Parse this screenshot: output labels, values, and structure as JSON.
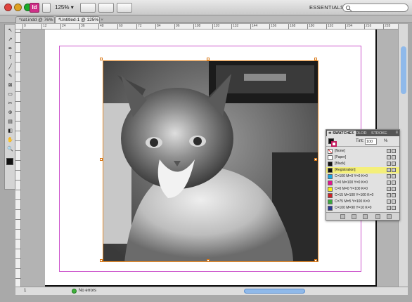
{
  "app": {
    "logo": "Id",
    "zoom": "125%",
    "workspace": "ESSENTIALS"
  },
  "tabs": [
    {
      "label": "*cat.indd @ 76%",
      "close": "×"
    },
    {
      "label": "*Untitled-1 @ 125%",
      "close": "×"
    }
  ],
  "tools": [
    "↖",
    "↗",
    "✒",
    "T",
    "╱",
    "✎",
    "⊠",
    "▭",
    "✂",
    "⊕",
    "▤",
    "◧",
    "✋",
    "🔍"
  ],
  "ruler_labels": [
    "0",
    "12",
    "24",
    "36",
    "48",
    "60",
    "72",
    "84",
    "96",
    "108",
    "120",
    "132",
    "144",
    "156",
    "168",
    "180",
    "192",
    "204",
    "216",
    "228",
    "240"
  ],
  "status": {
    "page": "1",
    "errors": "No errors"
  },
  "swatches_panel": {
    "tabs": [
      "≑ SWATCHES",
      "COLOR",
      "STROKE"
    ],
    "menu": "≡",
    "tint_label": "Tint:",
    "tint_value": "100",
    "tint_unit": "%",
    "items": [
      {
        "name": "[None]",
        "color": "#ffffff"
      },
      {
        "name": "[Paper]",
        "color": "#ffffff"
      },
      {
        "name": "[Black]",
        "color": "#111111"
      },
      {
        "name": "[Registration]",
        "color": "#111111"
      },
      {
        "name": "C=100 M=0 Y=0 K=0",
        "color": "#18a8e0"
      },
      {
        "name": "C=0 M=100 Y=0 K=0",
        "color": "#e0158f"
      },
      {
        "name": "C=0 M=0 Y=100 K=0",
        "color": "#f7ec13"
      },
      {
        "name": "C=15 M=100 Y=100 K=0",
        "color": "#cc2229"
      },
      {
        "name": "C=75 M=5 Y=100 K=0",
        "color": "#3aa63d"
      },
      {
        "name": "C=100 M=90 Y=10 K=0",
        "color": "#2b3a92"
      }
    ]
  }
}
